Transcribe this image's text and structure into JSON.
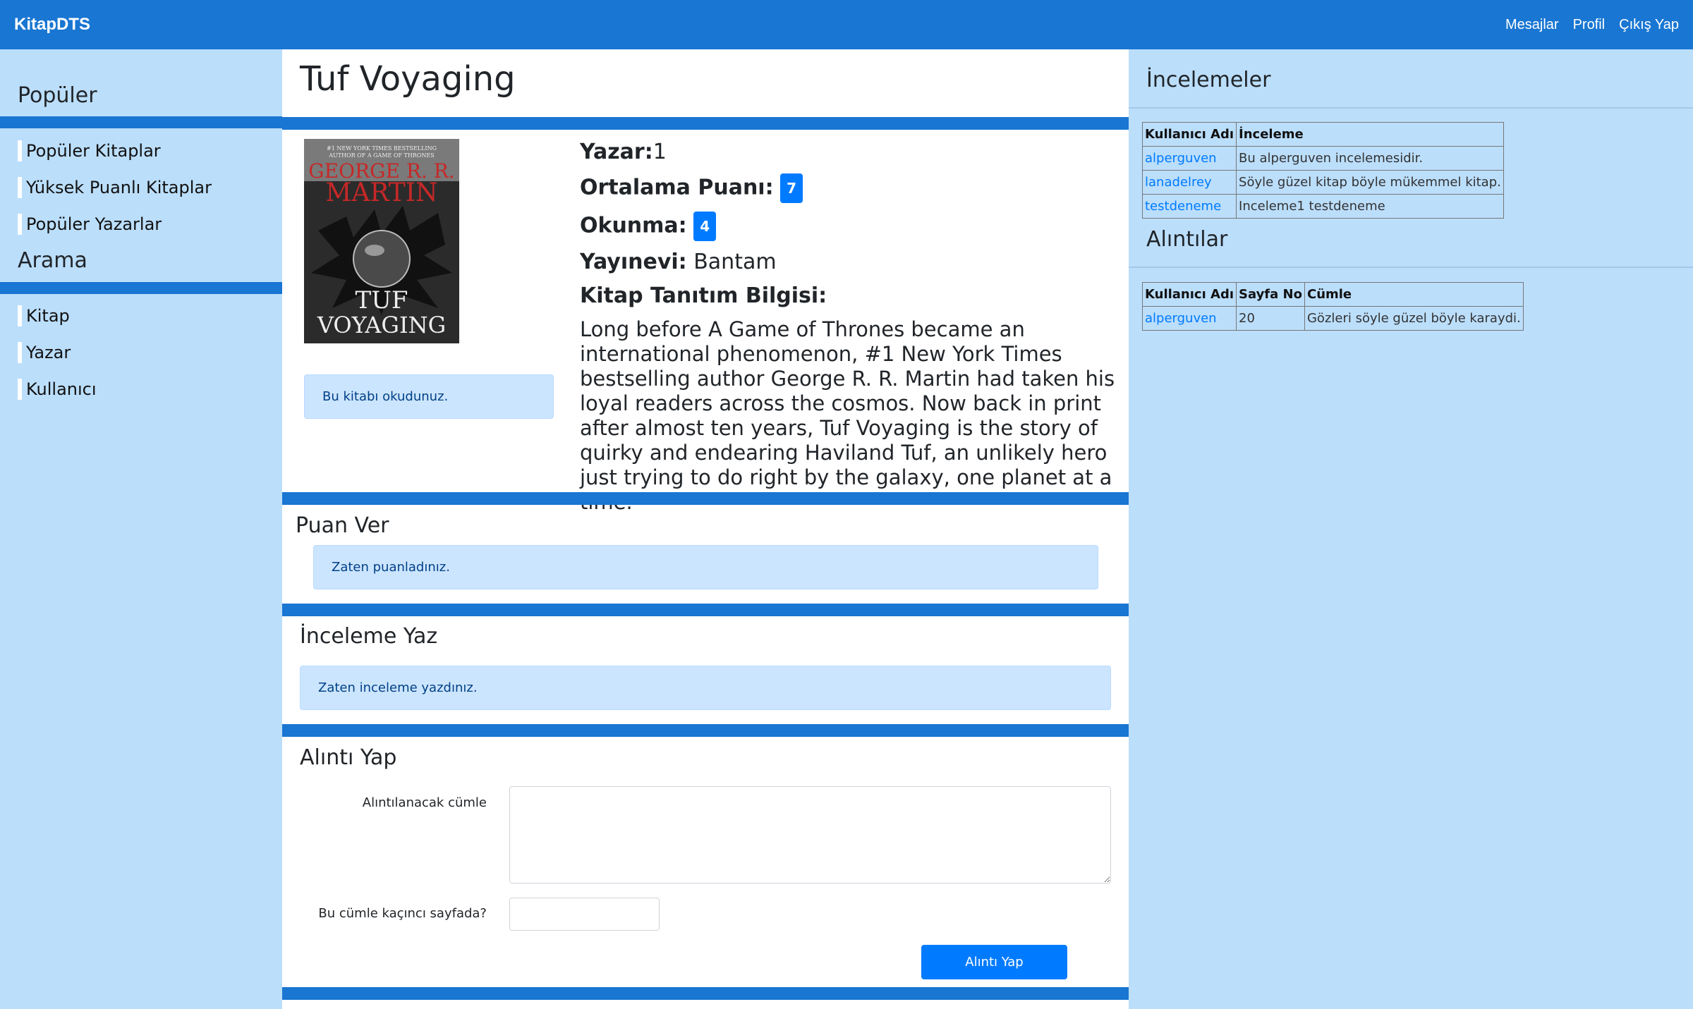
{
  "navbar": {
    "brand": "KitapDTS",
    "links": [
      "Mesajlar",
      "Profil",
      "Çıkış Yap"
    ]
  },
  "sidebar": {
    "popular_heading": "Popüler",
    "popular_items": [
      "Popüler Kitaplar",
      "Yüksek Puanlı Kitaplar",
      "Popüler Yazarlar"
    ],
    "search_heading": "Arama",
    "search_items": [
      "Kitap",
      "Yazar",
      "Kullanıcı"
    ]
  },
  "book": {
    "title": "Tuf Voyaging",
    "author_label": "Yazar:",
    "author_value": "1",
    "rating_label": "Ortalama Puanı:",
    "rating_value": "7",
    "read_label": "Okunma:",
    "read_value": "4",
    "publisher_label": "Yayınevi:",
    "publisher_value": "Bantam",
    "desc_label": "Kitap Tanıtım Bilgisi:",
    "description": "Long before A Game of Thrones became an international phenomenon, #1 New York Times bestselling author George R. R. Martin had taken his loyal readers across the cosmos. Now back in print after almost ten years, Tuf Voyaging is the story of quirky and endearing Haviland Tuf, an unlikely hero just trying to do right by the galaxy, one planet at a time.",
    "read_alert": "Bu kitabı okudunuz.",
    "cover": {
      "top_line1": "#1 NEW YORK TIMES BESTSELLING",
      "top_line2": "AUTHOR OF A GAME OF THRONES",
      "author": "GEORGE R. R.",
      "author2": "MARTIN",
      "title1": "TUF",
      "title2": "VOYAGING"
    }
  },
  "rate": {
    "heading": "Puan Ver",
    "alert": "Zaten puanladınız."
  },
  "review_write": {
    "heading": "İnceleme Yaz",
    "alert": "Zaten inceleme yazdınız."
  },
  "quote_form": {
    "heading": "Alıntı Yap",
    "sentence_label": "Alıntılanacak cümle",
    "page_label": "Bu cümle kaçıncı sayfada?",
    "submit_label": "Alıntı Yap"
  },
  "reviews": {
    "heading": "İncelemeler",
    "columns": [
      "Kullanıcı Adı",
      "İnceleme"
    ],
    "rows": [
      [
        "alperguven",
        "Bu alperguven incelemesidir."
      ],
      [
        "lanadelrey",
        "Söyle güzel kitap böyle mükemmel kitap."
      ],
      [
        "testdeneme",
        "Inceleme1 testdeneme"
      ]
    ]
  },
  "quotes": {
    "heading": "Alıntılar",
    "columns": [
      "Kullanıcı Adı",
      "Sayfa No",
      "Cümle"
    ],
    "rows": [
      [
        "alperguven",
        "20",
        "Gözleri söyle güzel böyle karaydi."
      ]
    ]
  },
  "colors": {
    "primary": "#1976d2",
    "background": "#bbdefb",
    "badge": "#007bff",
    "alert_bg": "#cce5ff"
  }
}
